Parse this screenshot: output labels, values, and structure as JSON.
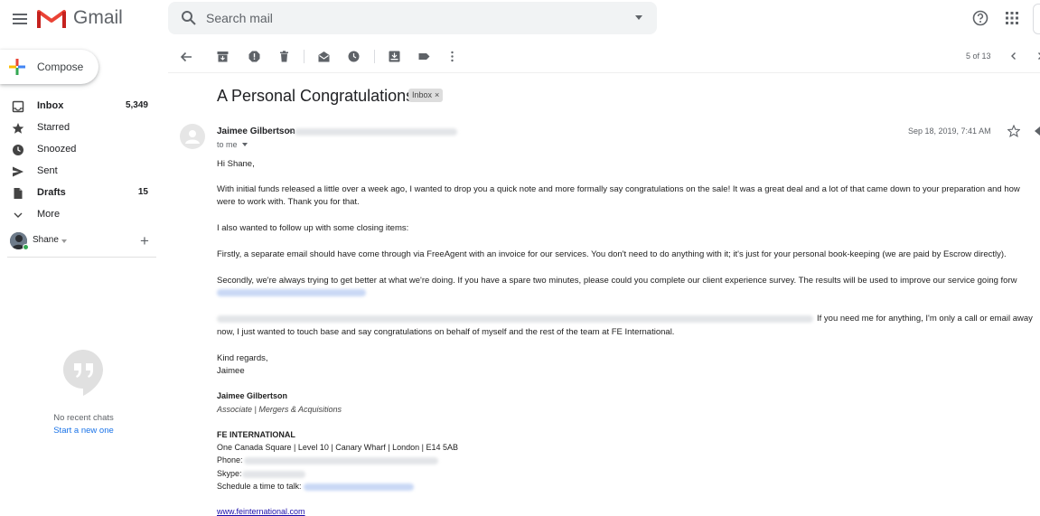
{
  "header": {
    "app_name": "Gmail",
    "search_placeholder": "Search mail"
  },
  "sidebar": {
    "compose_label": "Compose",
    "items": [
      {
        "label": "Inbox",
        "count": "5,349",
        "icon": "inbox-icon"
      },
      {
        "label": "Starred",
        "count": "",
        "icon": "star-icon"
      },
      {
        "label": "Snoozed",
        "count": "",
        "icon": "clock-icon"
      },
      {
        "label": "Sent",
        "count": "",
        "icon": "send-icon"
      },
      {
        "label": "Drafts",
        "count": "15",
        "icon": "draft-icon"
      },
      {
        "label": "More",
        "count": "",
        "icon": "chevron-down-icon"
      }
    ],
    "user_name": "Shane",
    "add_chat": "+",
    "no_chats": "No recent chats",
    "start_new": "Start a new one"
  },
  "toolbar": {
    "pager": "5 of 13",
    "icons": [
      "back-icon",
      "archive-icon",
      "report-spam-icon",
      "delete-icon",
      "mark-unread-icon",
      "snooze-icon",
      "move-to-icon",
      "label-icon",
      "more-icon",
      "older-icon",
      "newer-icon"
    ]
  },
  "message": {
    "subject": "A Personal Congratulations!",
    "label": "Inbox",
    "label_close": "×",
    "sender_name": "Jaimee Gilbertson",
    "sender_email_prefix": "<",
    "to": "to me",
    "date": "Sep 18, 2019, 7:41 AM",
    "greeting": "Hi Shane,",
    "p1_line1": "With initial funds released a little over a week ago, I wanted to drop you a quick note and more formally say congratulations on the sale! It was a great deal and a lot of that came down to your preparation and how",
    "p1_line2": "were to work with. Thank you for that.",
    "p2": "I also wanted to follow up with some closing items:",
    "p3": "Firstly, a separate email should have come through via FreeAgent with an invoice for our services. You don't need to do anything with it; it's just for your personal book-keeping (we are paid by Escrow directly).",
    "p4": "Secondly, we're always trying to get better at what we're doing. If you have a spare two minutes, please could you complete our client experience survey. The results will be used to improve our service going forw",
    "p5_visible": "If you need me for anything, I'm only a call or email away",
    "p5_line2": "now, I just wanted to touch base and say congratulations on behalf of myself and the rest of the team at FE International.",
    "closing": "Kind regards,",
    "closing_name": "Jaimee"
  },
  "signature": {
    "name": "Jaimee Gilbertson",
    "title": "Associate | Mergers & Acquisitions",
    "company": "FE INTERNATIONAL",
    "address": "One Canada Square | Level 10 | Canary Wharf | London | E14 5AB",
    "phone_label": "Phone:",
    "skype_label": "Skype:",
    "schedule_label": "Schedule a time to talk:",
    "website": "www.feinternational.com"
  },
  "colors": {
    "accent_blue": "#1a73e8",
    "gmail_red": "#ea4335",
    "presence_green": "#34a853"
  }
}
